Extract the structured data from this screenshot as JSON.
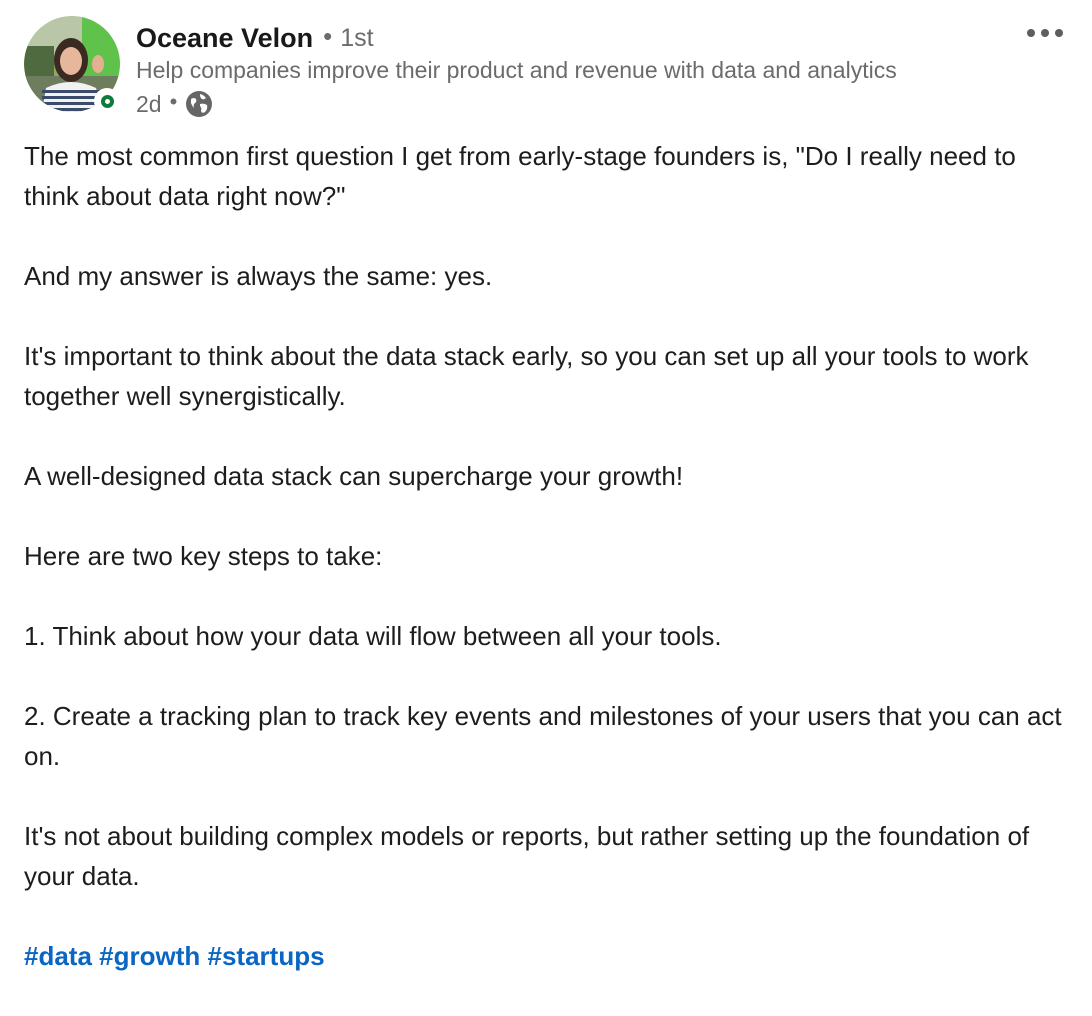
{
  "author": {
    "name": "Oceane Velon",
    "separator": "•",
    "connection_degree": "1st",
    "headline": "Help companies improve their product and revenue with data and analytics",
    "posted_time": "2d",
    "meta_separator": "•",
    "visibility_icon": "globe-icon",
    "avatar_icon": "profile-photo",
    "status_icon": "online-status-icon"
  },
  "actions": {
    "more_icon": "more-options-icon"
  },
  "post": {
    "paragraphs": [
      "The most common first question I get from early-stage founders is, \"Do I really need to think about data right now?\"",
      "And my answer is always the same: yes.",
      "It's important to think about the data stack early, so you can set up all your tools to work together well synergistically.",
      "A well-designed data stack can supercharge your growth!",
      "Here are two key steps to take:",
      "1. Think about how your data will flow between all your tools.",
      "2. Create a tracking plan to track key events and milestones of your users that you can act on.",
      "It's not about building complex models or reports, but rather setting up the foundation of your data."
    ],
    "hashtags": [
      "#data",
      "#growth",
      "#startups"
    ]
  },
  "colors": {
    "hashtag": "#0a66c2",
    "online_status": "#0f7b3b",
    "secondary_text": "#6b6b6b",
    "primary_text": "#1d1d1d"
  }
}
